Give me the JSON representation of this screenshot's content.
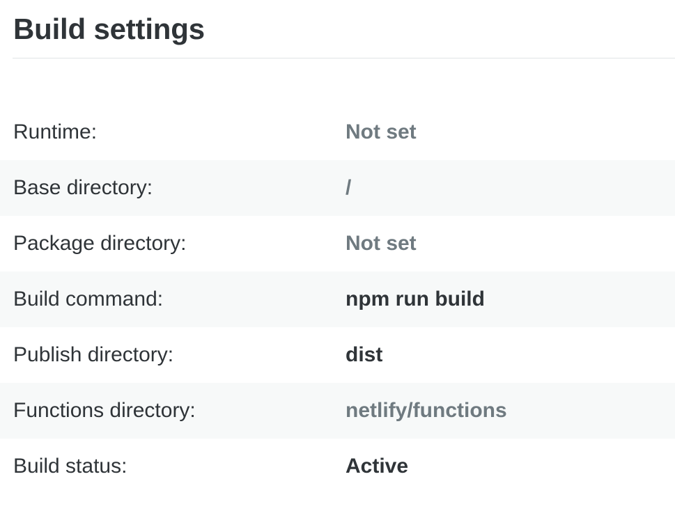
{
  "header": {
    "title": "Build settings"
  },
  "settings": [
    {
      "label": "Runtime:",
      "value": "Not set",
      "style": "muted"
    },
    {
      "label": "Base directory:",
      "value": "/",
      "style": "muted"
    },
    {
      "label": "Package directory:",
      "value": "Not set",
      "style": "muted"
    },
    {
      "label": "Build command:",
      "value": "npm run build",
      "style": "strong"
    },
    {
      "label": "Publish directory:",
      "value": "dist",
      "style": "strong"
    },
    {
      "label": "Functions directory:",
      "value": "netlify/functions",
      "style": "muted"
    },
    {
      "label": "Build status:",
      "value": "Active",
      "style": "strong"
    }
  ],
  "colors": {
    "text": "#2f3438",
    "muted_value": "#6f7a80",
    "alt_row_background": "#f7f9f9",
    "divider": "#dfe3e6"
  }
}
